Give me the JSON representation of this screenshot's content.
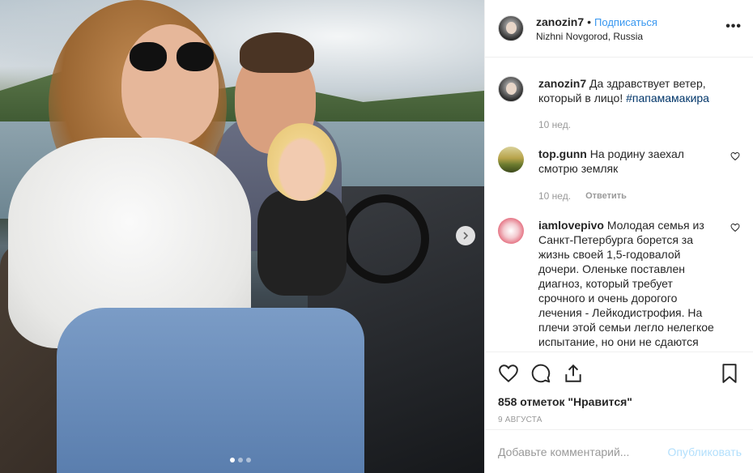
{
  "post": {
    "username": "zanozin7",
    "follow_label": "Подписаться",
    "dot": "•",
    "location": "Nizhni Novgorod, Russia"
  },
  "comments": [
    {
      "username": "zanozin7",
      "text": "Да здравствует ветер, который в лицо! ",
      "hashtag": "#папамамакира",
      "time": "10 нед."
    },
    {
      "username": "top.gunn",
      "text": "На родину заехал смотрю земляк",
      "time": "10 нед.",
      "reply_label": "Ответить"
    },
    {
      "username": "iamlovepivo",
      "text": "Молодая семья из Санкт-Петербурга борется за жизнь своей 1,5-годовалой дочери. Оленьке поставлен диагноз, который требует срочного и очень дорогого лечения - Лейкодистрофия. На плечи этой семьи легло нелегкое испытание, но они не сдаются"
    }
  ],
  "actions": {
    "likes": "858 отметок \"Нравится\"",
    "date": "9 августа"
  },
  "comment_box": {
    "placeholder": "Добавьте комментарий...",
    "publish_label": "Опубликовать"
  },
  "icons": {
    "more": "more-options-icon",
    "like": "heart-icon",
    "comment": "comment-icon",
    "share": "share-icon",
    "save": "bookmark-icon",
    "next": "chevron-right-icon"
  },
  "colors": {
    "link": "#3897f0",
    "hashtag": "#003569",
    "muted": "#999999",
    "publish_disabled": "#b2dffc"
  },
  "carousel": {
    "current_index": 1,
    "slides": 3
  }
}
